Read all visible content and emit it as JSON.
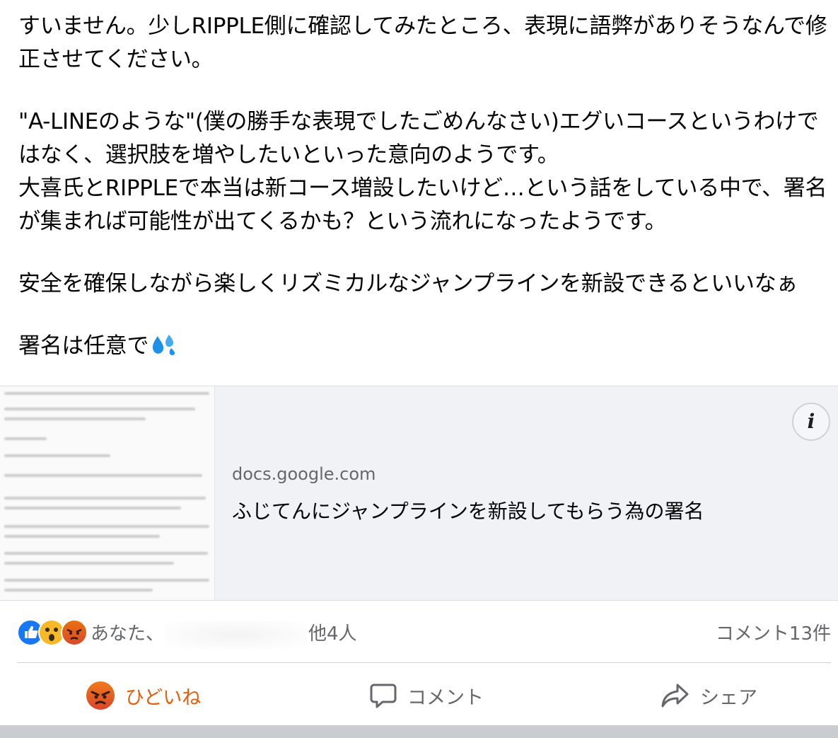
{
  "post": {
    "paragraphs": [
      "すいません。少しRIPPLE側に確認してみたところ、表現に語弊がありそうなんで修正させてください。",
      "\"A-LINEのような\"(僕の勝手な表現でしたごめんなさい)エグいコースというわけではなく、選択肢を増やしたいといった意向のようです。\n大喜氏とRIPPLEで本当は新コース増設したいけど…という話をしている中で、署名が集まれば可能性が出てくるかも？という流れになったようです。",
      "安全を確保しながら楽しくリズミカルなジャンプラインを新設できるといいなぁ",
      "署名は任意で"
    ],
    "emoji_icon": "sweat-droplets"
  },
  "link_card": {
    "domain": "docs.google.com",
    "title": "ふじてんにジャンプラインを新設してもらう為の署名",
    "info_label": "i"
  },
  "reactions": {
    "icons": [
      "like",
      "wow",
      "angry"
    ],
    "prefix": "あなた、",
    "suffix": "他4人"
  },
  "comments_count": "コメント13件",
  "actions": {
    "react_label": "ひどいね",
    "comment_label": "コメント",
    "share_label": "シェア"
  },
  "colors": {
    "react_active": "#e06010",
    "link_bg": "#f0f2f5",
    "secondary_text": "#65676b"
  }
}
